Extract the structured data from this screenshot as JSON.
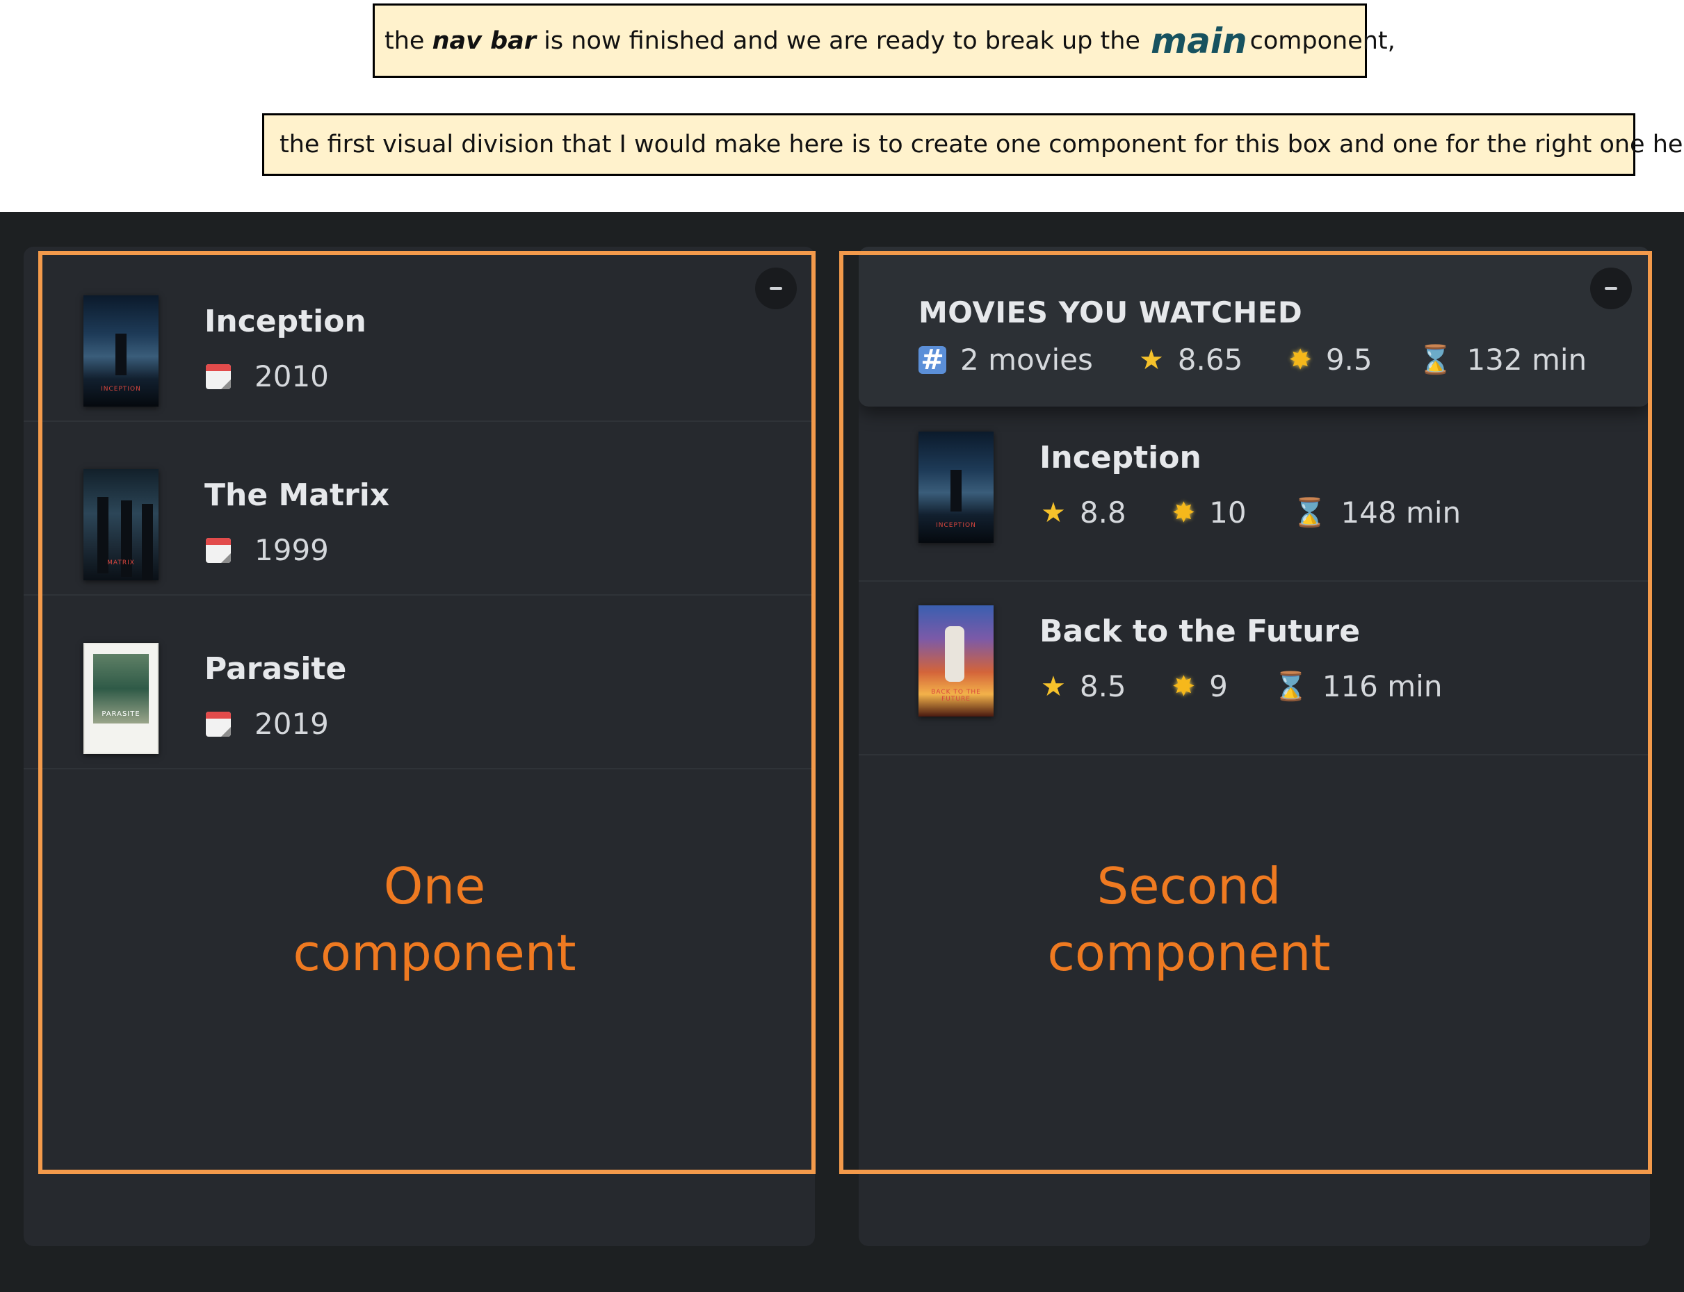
{
  "annotations": {
    "note1": {
      "part1": "the ",
      "nav_bar": "nav bar",
      "part2": " is now finished and we are ready to break up the ",
      "main_word": "main",
      "part3": " component,"
    },
    "note2": "the first visual division that I would make here is to create one component for this box and one for the right one here.",
    "left_label_line1": "One",
    "left_label_line2": "component",
    "right_label_line1": "Second",
    "right_label_line2": "component",
    "outline_color": "#f39a4b",
    "label_color": "#ef7a21"
  },
  "movie_list": {
    "toggle_icon": "minus-icon",
    "items": [
      {
        "title": "Inception",
        "year": "2010",
        "poster": "inception-poster"
      },
      {
        "title": "The Matrix",
        "year": "1999",
        "poster": "matrix-poster"
      },
      {
        "title": "Parasite",
        "year": "2019",
        "poster": "parasite-poster"
      }
    ],
    "year_icon": "calendar-icon"
  },
  "watched": {
    "toggle_icon": "minus-icon",
    "summary": {
      "title": "MOVIES YOU WATCHED",
      "count": "2 movies",
      "imdb_rating": "8.65",
      "user_rating": "9.5",
      "runtime": "132 min"
    },
    "items": [
      {
        "title": "Inception",
        "imdb_rating": "8.8",
        "user_rating": "10",
        "runtime": "148 min",
        "poster": "inception-poster"
      },
      {
        "title": "Back to the Future",
        "imdb_rating": "8.5",
        "user_rating": "9",
        "runtime": "116 min",
        "poster": "back-to-the-future-poster"
      }
    ],
    "icons": {
      "count": "hash-icon",
      "imdb": "star-icon",
      "user": "glowing-star-icon",
      "runtime": "hourglass-icon"
    }
  },
  "colors": {
    "app_background": "#1d2022",
    "panel_background": "#26292e",
    "summary_background": "#2c3035",
    "note_background": "#fff2cc",
    "main_word_color": "#17525f"
  }
}
